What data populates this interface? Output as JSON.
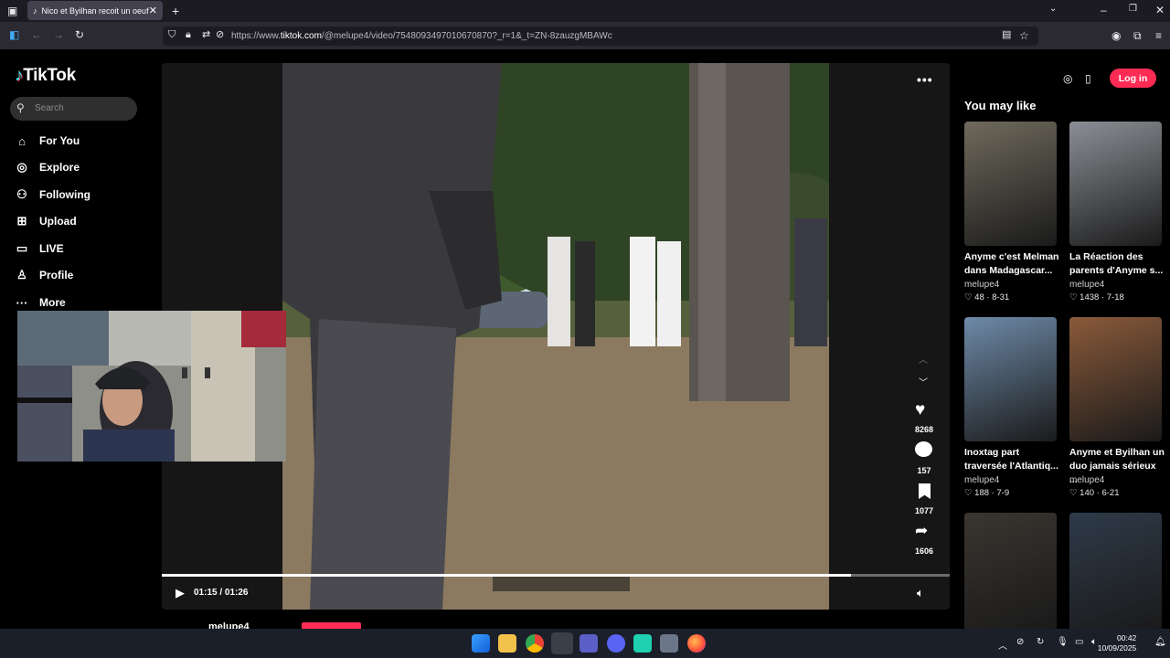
{
  "browser": {
    "tab_title": "Nico et Byilhan recoit un oeuf d",
    "url_prefix": "https://www.",
    "url_domain": "tiktok.com",
    "url_path": "/@melupe4/video/7548093497010670870?_r=1&_t=ZN-8zauzgMBAWc"
  },
  "sidebar": {
    "logo": "TikTok",
    "search_placeholder": "Search",
    "items": [
      {
        "label": "For You",
        "icon": "home-icon"
      },
      {
        "label": "Explore",
        "icon": "compass-icon"
      },
      {
        "label": "Following",
        "icon": "following-icon"
      },
      {
        "label": "Upload",
        "icon": "upload-icon"
      },
      {
        "label": "LIVE",
        "icon": "live-icon"
      },
      {
        "label": "Profile",
        "icon": "profile-icon"
      },
      {
        "label": "More",
        "icon": "more-icon"
      }
    ]
  },
  "video": {
    "time": "01:15 / 01:26",
    "progress": 0.875,
    "author": "melupe4",
    "likes": "8268",
    "comments": "157",
    "saves": "1077",
    "shares": "1606"
  },
  "header": {
    "login_label": "Log in"
  },
  "recommendations": {
    "title": "You may like",
    "cards": [
      {
        "title": "Anyme c'est Melman dans Madagascar...",
        "author": "melupe4",
        "likes": "48",
        "date": "8-31",
        "thumb_color": "#6f6a5c"
      },
      {
        "title": "La Réaction des parents d'Anyme s...",
        "author": "melupe4",
        "likes": "1438",
        "date": "7-18",
        "thumb_color": "#8b8f95"
      },
      {
        "title": "Inoxtag part traversée l'Atlantiq...",
        "author": "melupe4",
        "likes": "188",
        "date": "7-9",
        "thumb_color": "#6e8aa8"
      },
      {
        "title": "Anyme et Byilhan un duo jamais sérieux ...",
        "author": "melupe4",
        "likes": "140",
        "date": "6-21",
        "thumb_color": "#8a5a3a"
      },
      {
        "title": "",
        "author": "",
        "likes": "",
        "date": "",
        "thumb_color": "#3a3530"
      },
      {
        "title": "",
        "author": "",
        "likes": "",
        "date": "",
        "thumb_color": "#2f3b4a"
      }
    ]
  },
  "taskbar": {
    "time": "00:42",
    "date": "10/09/2025"
  }
}
